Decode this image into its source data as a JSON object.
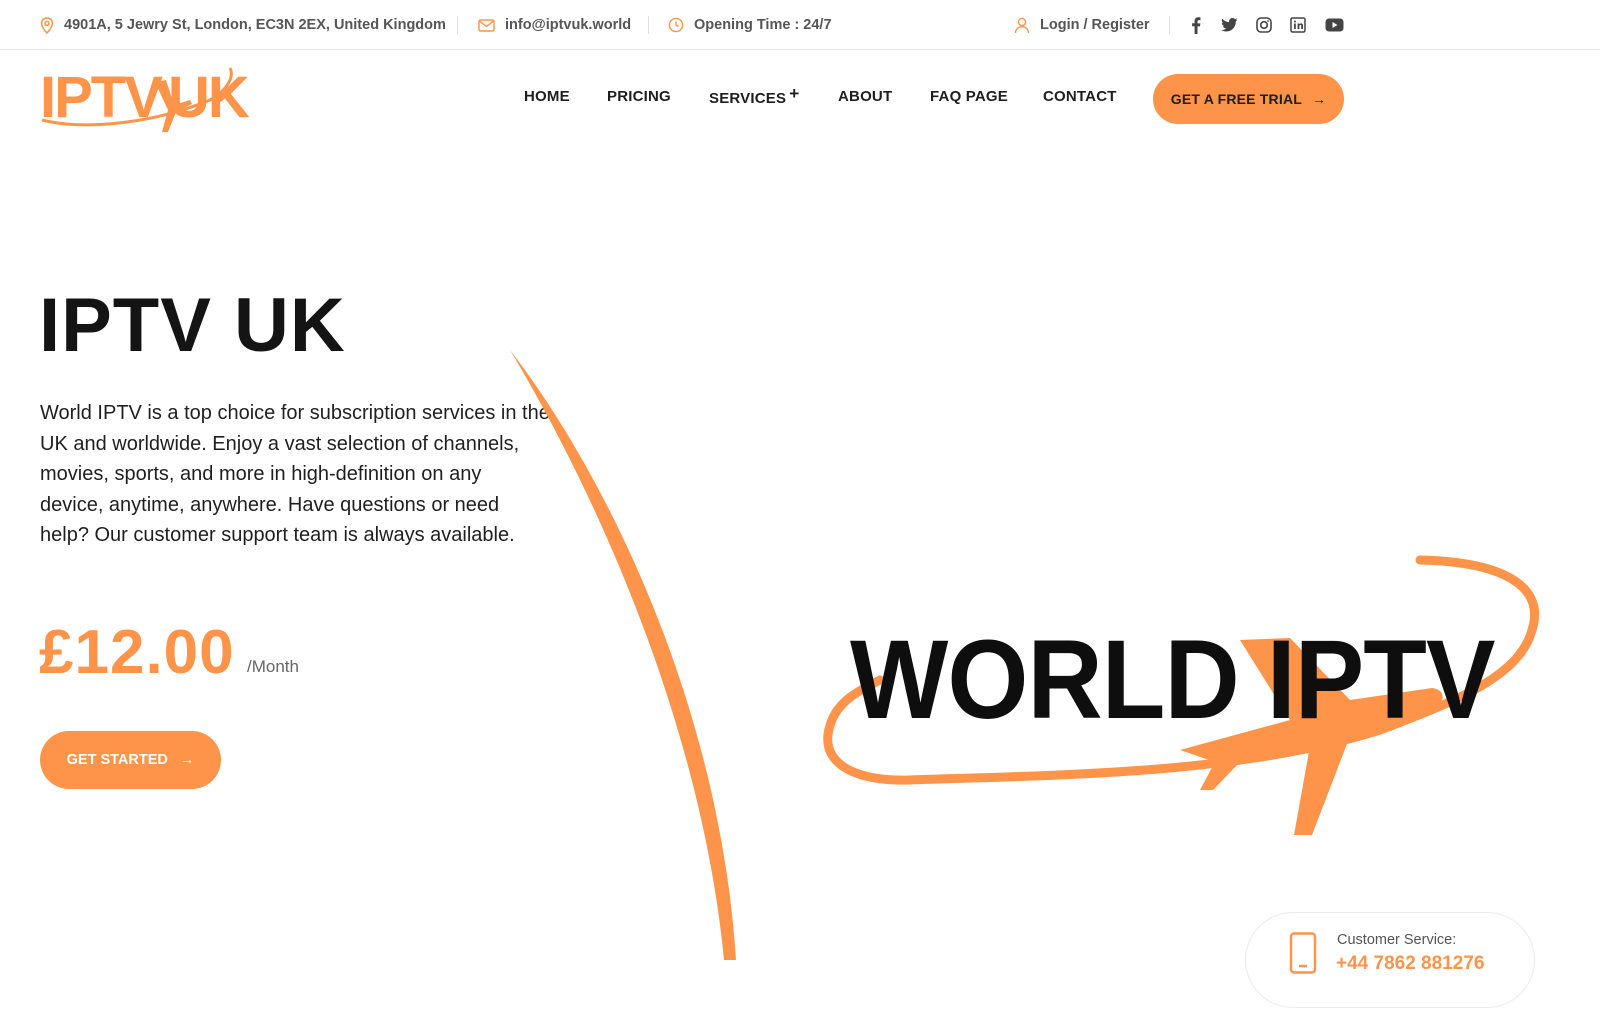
{
  "topbar": {
    "address": "4901A, 5 Jewry St, London, EC3N 2EX, United Kingdom",
    "email": "info@iptvuk.world",
    "opening": "Opening Time : 24/7",
    "login": "Login / Register",
    "socials": [
      "facebook-icon",
      "twitter-icon",
      "instagram-icon",
      "linkedin-icon",
      "youtube-icon"
    ]
  },
  "logo": {
    "text": "IPTVUK"
  },
  "nav": {
    "home": "HOME",
    "pricing": "PRICING",
    "services": "SERVICES",
    "services_plus": "+",
    "about": "ABOUT",
    "faq": "FAQ PAGE",
    "contact": "CONTACT"
  },
  "cta": {
    "trial": "GET A FREE TRIAL",
    "arrow": "→"
  },
  "hero": {
    "title": "IPTV UK",
    "description": "World IPTV is a top choice for subscription services in the UK and worldwide. Enjoy a vast selection of channels, movies, sports, and more in high-definition on any device, anytime, anywhere. Have questions or need help? Our customer support team is always available.",
    "price": "£12.00",
    "period": "/Month",
    "start": "GET STARTED",
    "arrow": "→"
  },
  "banner": {
    "text": "WORLD IPTV"
  },
  "customer_service": {
    "label": "Customer Service:",
    "phone": "+44 7862 881276"
  },
  "colors": {
    "accent": "#fe934a",
    "text": "#1a1a1a",
    "muted": "#555555"
  }
}
